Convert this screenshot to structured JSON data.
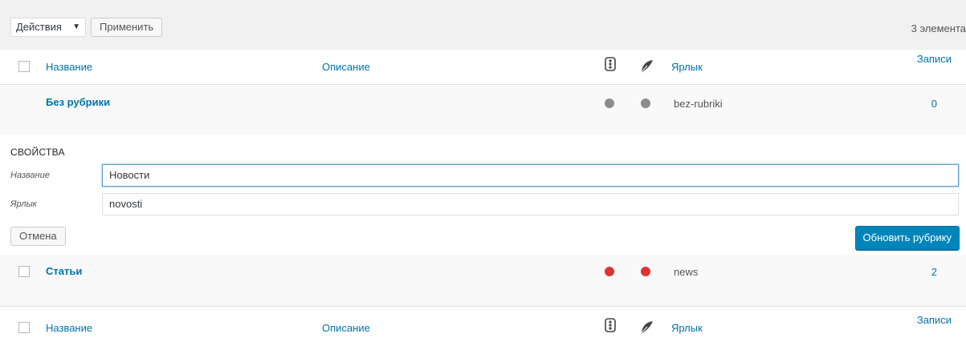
{
  "bulk": {
    "actions_label": "Действия",
    "apply_label": "Применить",
    "items_count": "3 элемента"
  },
  "columns": {
    "name": "Название",
    "description": "Описание",
    "slug": "Ярлык",
    "posts": "Записи"
  },
  "rows": [
    {
      "name": "Без рубрики",
      "slug": "bez-rubriki",
      "count": "0",
      "status_color": "#8c8c8c"
    },
    {
      "name": "Статьи",
      "slug": "news",
      "count": "2",
      "status_color": "#dd3333"
    }
  ],
  "quick_edit": {
    "title": "СВОЙСТВА",
    "name_label": "Название",
    "name_value": "Новости",
    "slug_label": "Ярлык",
    "slug_value": "novosti",
    "cancel_label": "Отмена",
    "update_label": "Обновить рубрику"
  },
  "icons": {
    "status_column": "indicator-icon",
    "feather_column": "feather-icon"
  },
  "colors": {
    "link": "#0073aa",
    "primary_button": "#0085ba"
  }
}
